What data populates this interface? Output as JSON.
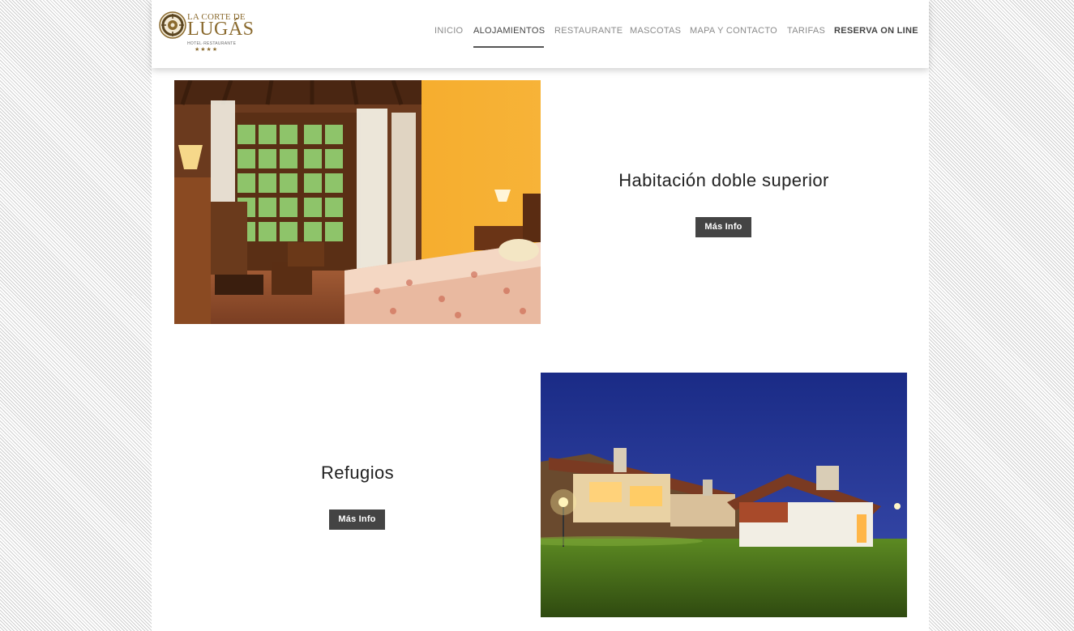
{
  "logo": {
    "top_text": "LA CORTE DE",
    "main_text": "LUGÁS",
    "sub_text": "HOTEL·RESTAURANTE",
    "stars": "★★★★"
  },
  "nav": {
    "items": [
      {
        "label": "INICIO"
      },
      {
        "label": "ALOJAMIENTOS"
      },
      {
        "label": "RESTAURANTE"
      },
      {
        "label": "MASCOTAS"
      },
      {
        "label": "MAPA Y CONTACTO"
      },
      {
        "label": "TARIFAS"
      },
      {
        "label": "RESERVA ON LINE"
      }
    ],
    "active": "ALOJAMIENTOS"
  },
  "rooms": [
    {
      "title": "Habitación doble superior",
      "button": "Más Info"
    },
    {
      "title": "Refugios",
      "button": "Más Info"
    }
  ],
  "colors": {
    "brand_gold": "#8a6a2e",
    "button_bg": "#444444",
    "nav_text": "#8a8a8a"
  }
}
